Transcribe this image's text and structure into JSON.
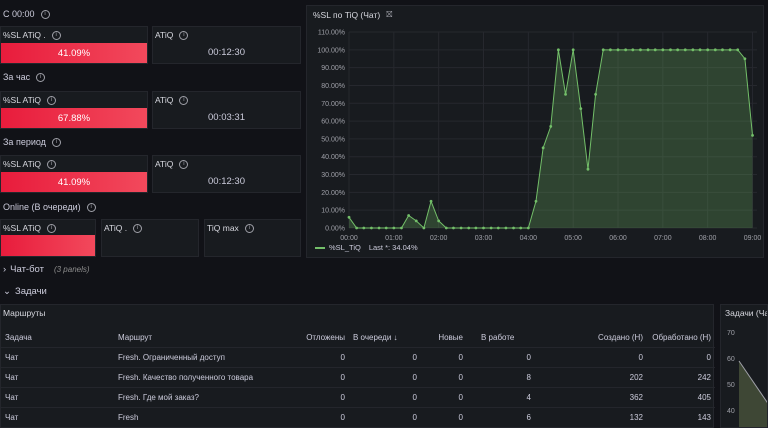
{
  "sections": {
    "since": "С 00:00",
    "hour": "За час",
    "period": "За период",
    "online": "Online (В очереди)"
  },
  "stats": {
    "since_sl_title": "%SL ATiQ .",
    "since_sl_value": "41.09%",
    "since_atiq_title": "ATiQ",
    "since_atiq_value": "00:12:30",
    "hour_sl_title": "%SL ATiQ",
    "hour_sl_value": "67.88%",
    "hour_atiq_title": "ATiQ",
    "hour_atiq_value": "00:03:31",
    "period_sl_title": "%SL ATiQ",
    "period_sl_value": "41.09%",
    "period_atiq_title": "ATiQ",
    "period_atiq_value": "00:12:30",
    "online_sl_title": "%SL ATiQ",
    "online_atiq_title": "ATiQ .",
    "online_tiqmax_title": "TiQ max"
  },
  "chart_panel": {
    "title": "%SL по TiQ (Чат)",
    "legend_label": "%SL_TiQ",
    "legend_last": "Last *: 34.04%"
  },
  "chart_data": {
    "type": "area",
    "title": "%SL по TiQ (Чат)",
    "y_ticks": [
      "0.00%",
      "10.00%",
      "20.00%",
      "30.00%",
      "40.00%",
      "50.00%",
      "60.00%",
      "70.00%",
      "80.00%",
      "90.00%",
      "100.00%",
      "110.00%"
    ],
    "x_ticks": [
      "00:00",
      "01:00",
      "02:00",
      "03:00",
      "04:00",
      "05:00",
      "06:00",
      "07:00",
      "08:00",
      "09:00"
    ],
    "ylim": [
      0,
      110
    ],
    "xlim_hours": [
      0,
      9.1
    ],
    "series": [
      {
        "name": "%SL_TiQ",
        "color": "#73bf69",
        "x_hours": [
          0,
          0.17,
          0.33,
          0.5,
          0.67,
          0.83,
          1.0,
          1.17,
          1.33,
          1.5,
          1.67,
          1.83,
          2.0,
          2.17,
          2.33,
          2.5,
          2.67,
          2.83,
          3.0,
          3.17,
          3.33,
          3.5,
          3.67,
          3.83,
          4.0,
          4.17,
          4.33,
          4.5,
          4.67,
          4.83,
          5.0,
          5.17,
          5.33,
          5.5,
          5.67,
          5.83,
          6.0,
          6.17,
          6.33,
          6.5,
          6.67,
          6.83,
          7.0,
          7.17,
          7.33,
          7.5,
          7.67,
          7.83,
          8.0,
          8.17,
          8.33,
          8.5,
          8.67,
          8.83,
          9.0
        ],
        "values": [
          6,
          0,
          0,
          0,
          0,
          0,
          0,
          0,
          7,
          4,
          0,
          15,
          4,
          0,
          0,
          0,
          0,
          0,
          0,
          0,
          0,
          0,
          0,
          0,
          0,
          15,
          45,
          57,
          100,
          75,
          100,
          67,
          33,
          75,
          100,
          100,
          100,
          100,
          100,
          100,
          100,
          100,
          100,
          100,
          100,
          100,
          100,
          100,
          100,
          100,
          100,
          100,
          100,
          95,
          52,
          26,
          33,
          34
        ]
      }
    ]
  },
  "groups": {
    "chatbot_label": "Чат-бот",
    "chatbot_count": "(3 panels)",
    "tasks_label": "Задачи"
  },
  "routes_panel": {
    "title": "Маршруты",
    "headers": [
      "Задача",
      "Маршрут",
      "Отложены",
      "В очереди ↓",
      "Новые",
      "В работе",
      "Создано (Н)",
      "Обработано (Н)"
    ],
    "rows": [
      [
        "Чат",
        "Fresh. Ограниченный доступ",
        "0",
        "0",
        "0",
        "0",
        "0",
        "0"
      ],
      [
        "Чат",
        "Fresh. Качество полученного товара",
        "0",
        "0",
        "0",
        "8",
        "202",
        "242"
      ],
      [
        "Чат",
        "Fresh. Где мой заказ?",
        "0",
        "0",
        "0",
        "4",
        "362",
        "405"
      ],
      [
        "Чат",
        "Fresh",
        "0",
        "0",
        "0",
        "6",
        "132",
        "143"
      ]
    ]
  },
  "tasks_panel": {
    "title": "Задачи (Ча",
    "y_ticks": [
      "70",
      "60",
      "50",
      "40"
    ]
  }
}
